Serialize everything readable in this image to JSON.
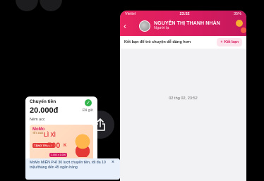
{
  "status_bar": {
    "carrier": "Viettel",
    "time": "23:52",
    "battery": "35%"
  },
  "contact": {
    "name": "NGUYỄN THỊ THANH NHÀN",
    "subtitle": "Người lạ"
  },
  "friend_bar": {
    "prompt": "Kết bạn để trò chuyện dễ dàng hơn",
    "button_label": "Kết bạn"
  },
  "chat": {
    "timestamp": "02 thg 02, 23:52"
  },
  "transfer_card": {
    "title": "Chuyển tiền",
    "amount": "20.000đ",
    "status": "Đã gửi",
    "note": "Ném acc",
    "banner": {
      "logo": "MoMo",
      "title": "LÌ XÌ",
      "left_tag": "TẶNG TRƯỚC",
      "amount": "500",
      "unit": "K",
      "tag": "1.000 x 1.000",
      "sub": "TẾT 2022"
    }
  },
  "promo": {
    "text": "MoMo MIỄN PHÍ 30 lượt chuyển tiền, tối đa 10 triệu/tháng đến 45 ngân hàng",
    "close": "×"
  },
  "share_button": {
    "icon": "share-icon"
  },
  "colors": {
    "brand": "#d81b60",
    "success": "#31b44b"
  }
}
